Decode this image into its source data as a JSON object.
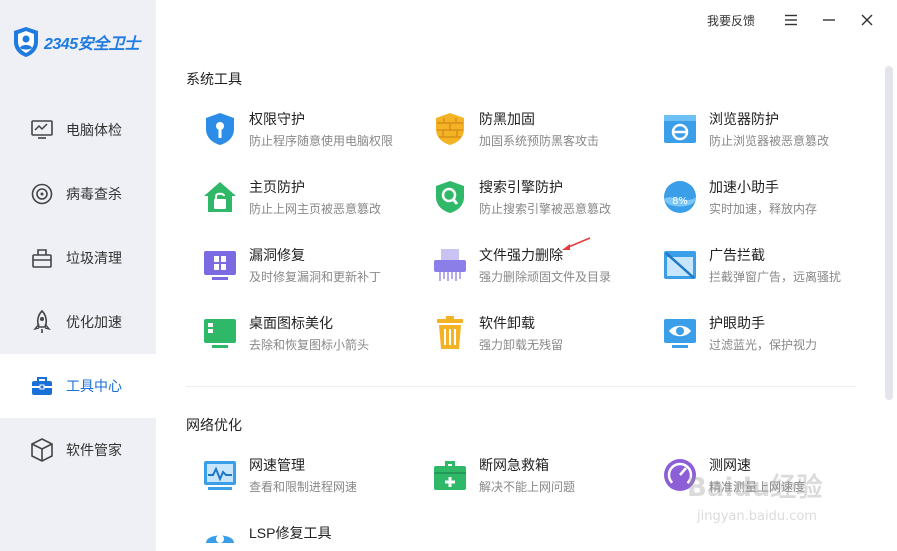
{
  "app": {
    "logo_text": "2345安全卫士"
  },
  "topbar": {
    "feedback_label": "我要反馈"
  },
  "sidebar": {
    "items": [
      {
        "label": "电脑体检",
        "icon": "monitor-check-icon"
      },
      {
        "label": "病毒查杀",
        "icon": "target-icon"
      },
      {
        "label": "垃圾清理",
        "icon": "trash-bin-icon"
      },
      {
        "label": "优化加速",
        "icon": "rocket-icon"
      },
      {
        "label": "工具中心",
        "icon": "toolbox-icon",
        "active": true
      },
      {
        "label": "软件管家",
        "icon": "cube-icon"
      }
    ]
  },
  "sections": [
    {
      "title": "系统工具",
      "tools": [
        {
          "name": "权限守护",
          "desc": "防止程序随意使用电脑权限",
          "icon": "shield-key-icon"
        },
        {
          "name": "防黑加固",
          "desc": "加固系统预防黑客攻击",
          "icon": "brick-shield-icon"
        },
        {
          "name": "浏览器防护",
          "desc": "防止浏览器被恶意篡改",
          "icon": "browser-icon"
        },
        {
          "name": "主页防护",
          "desc": "防止上网主页被恶意篡改",
          "icon": "home-lock-icon"
        },
        {
          "name": "搜索引擎防护",
          "desc": "防止搜索引擎被恶意篡改",
          "icon": "search-shield-icon"
        },
        {
          "name": "加速小助手",
          "desc": "实时加速，释放内存",
          "icon": "speed-ball-icon"
        },
        {
          "name": "漏洞修复",
          "desc": "及时修复漏洞和更新补丁",
          "icon": "windows-icon"
        },
        {
          "name": "文件强力删除",
          "desc": "强力删除顽固文件及目录",
          "icon": "shredder-icon"
        },
        {
          "name": "广告拦截",
          "desc": "拦截弹窗广告，远离骚扰",
          "icon": "ad-block-icon"
        },
        {
          "name": "桌面图标美化",
          "desc": "去除和恢复图标小箭头",
          "icon": "desktop-icon"
        },
        {
          "name": "软件卸载",
          "desc": "强力卸载无残留",
          "icon": "uninstall-bin-icon"
        },
        {
          "name": "护眼助手",
          "desc": "过滤蓝光，保护视力",
          "icon": "eye-care-icon"
        }
      ]
    },
    {
      "title": "网络优化",
      "tools": [
        {
          "name": "网速管理",
          "desc": "查看和限制进程网速",
          "icon": "net-monitor-icon"
        },
        {
          "name": "断网急救箱",
          "desc": "解决不能上网问题",
          "icon": "first-aid-icon"
        },
        {
          "name": "测网速",
          "desc": "精准测量上网速度",
          "icon": "speedometer-icon"
        },
        {
          "name": "LSP修复工具",
          "desc": "",
          "icon": "lsp-repair-icon"
        }
      ]
    }
  ],
  "watermark": {
    "text": "Baidu经验",
    "url": "jingyan.baidu.com"
  },
  "colors": {
    "accent": "#1b6fd8",
    "sidebar_bg": "#eef0f5"
  }
}
